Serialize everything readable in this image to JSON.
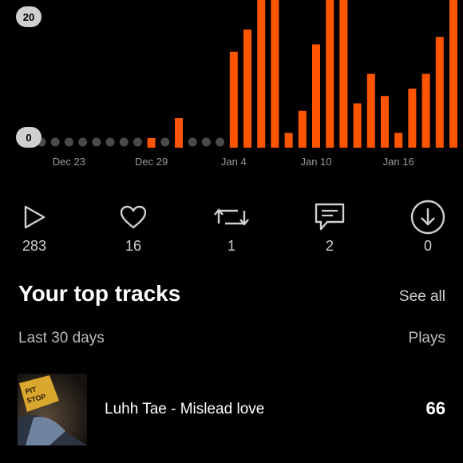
{
  "chart_data": {
    "type": "bar",
    "x": [
      "Dec 21",
      "Dec 22",
      "Dec 23",
      "Dec 24",
      "Dec 25",
      "Dec 26",
      "Dec 27",
      "Dec 28",
      "Dec 29",
      "Dec 30",
      "Dec 31",
      "Jan 1",
      "Jan 2",
      "Jan 3",
      "Jan 4",
      "Jan 5",
      "Jan 6",
      "Jan 7",
      "Jan 8",
      "Jan 9",
      "Jan 10",
      "Jan 11",
      "Jan 12",
      "Jan 13",
      "Jan 14",
      "Jan 15",
      "Jan 16",
      "Jan 17",
      "Jan 18",
      "Jan 19",
      "Jan 20",
      "Jan 21"
    ],
    "values": [
      0,
      0,
      0,
      0,
      0,
      0,
      0,
      0,
      1,
      0,
      4,
      0,
      0,
      0,
      13,
      16,
      20,
      20,
      2,
      5,
      14,
      20,
      20,
      6,
      10,
      7,
      2,
      8,
      10,
      15,
      20,
      9
    ],
    "tick_labels": [
      "Dec 23",
      "Dec 29",
      "Jan 4",
      "Jan 10",
      "Jan 16"
    ],
    "ylim": [
      0,
      20
    ],
    "y_labels": [
      "20",
      "0"
    ],
    "bar_color": "#ff5500",
    "zero_dot_color": "#4a4a4a"
  },
  "stats": [
    {
      "icon": "play-icon",
      "value": "283"
    },
    {
      "icon": "heart-icon",
      "value": "16"
    },
    {
      "icon": "repost-icon",
      "value": "1"
    },
    {
      "icon": "comment-icon",
      "value": "2"
    },
    {
      "icon": "download-icon",
      "value": "0"
    }
  ],
  "top_tracks": {
    "title": "Your top tracks",
    "see_all": "See all",
    "period": "Last 30 days",
    "plays_header": "Plays",
    "items": [
      {
        "artwork_text": "PIT STOP",
        "title": "Luhh Tae - Mislead love",
        "plays": "66"
      }
    ]
  }
}
